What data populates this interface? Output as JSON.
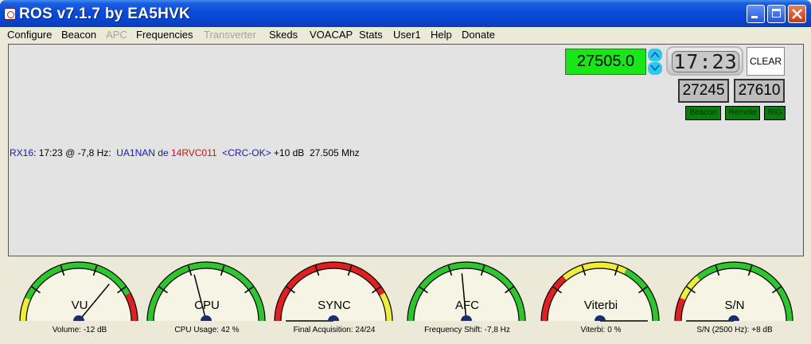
{
  "window": {
    "title": "ROS v7.1.7 by EA5HVK"
  },
  "menu": [
    {
      "label": "Configure",
      "enabled": true
    },
    {
      "label": "Beacon",
      "enabled": true
    },
    {
      "label": "APC",
      "enabled": false
    },
    {
      "label": "Frequencies",
      "enabled": true
    },
    {
      "label": "Transverter",
      "enabled": false
    },
    {
      "label": "Skeds",
      "enabled": true
    },
    {
      "label": "VOACAP",
      "enabled": true
    },
    {
      "label": "Stats",
      "enabled": true
    },
    {
      "label": "User1",
      "enabled": true
    },
    {
      "label": "Help",
      "enabled": true
    },
    {
      "label": "Donate",
      "enabled": true
    }
  ],
  "controls": {
    "frequency": "27505.0",
    "clock": "17:23",
    "clear_label": "CLEAR",
    "range_low": "27245",
    "range_high": "27610",
    "flags": {
      "beacon": "Beacon",
      "remote": "Remote",
      "rig": "RIG"
    }
  },
  "rx_line": {
    "mode": "RX16",
    "time_offset": ": 17:23 @ -7,8 Hz:  ",
    "from_call": "UA1NAN",
    "de": " de ",
    "to_call": "14RVC011",
    "crc": "  <CRC-OK>",
    "snr_freq": " +10 dB  27.505 Mhz"
  },
  "gauges": [
    {
      "name": "VU",
      "caption": "Volume: -12 dB",
      "needle_fraction": 0.72
    },
    {
      "name": "CPU",
      "caption": "CPU Usage: 42 %",
      "needle_fraction": 0.42
    },
    {
      "name": "SYNC",
      "caption": "Final Acquisition: 24/24",
      "needle_fraction": 0.0
    },
    {
      "name": "AFC",
      "caption": "Frequency Shift: -7,8 Hz",
      "needle_fraction": 0.47
    },
    {
      "name": "Viterbi",
      "caption": "Viterbi: 0 %",
      "needle_fraction": 1.0
    },
    {
      "name": "S/N",
      "caption": "S/N (2500 Hz): +8 dB",
      "needle_fraction": 0.0
    }
  ],
  "colors": {
    "titlebar": "#0a4ad8",
    "frequency_bg": "#19e619",
    "flag_bg": "#0d7a0d",
    "gauge_green": "#2ec52e",
    "gauge_yellow": "#f0ec3c",
    "gauge_red": "#e02020",
    "gauge_face": "#f6f4e4"
  }
}
